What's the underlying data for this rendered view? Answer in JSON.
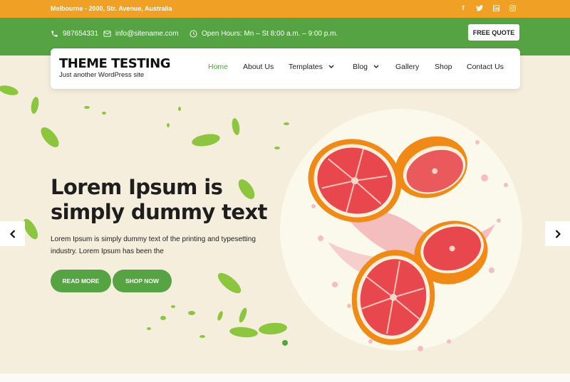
{
  "topbar": {
    "address": "Melbourne - 2000, Str. Avenue, Australia",
    "social": [
      {
        "icon": "facebook-icon",
        "glyph": "f"
      },
      {
        "icon": "twitter-icon",
        "glyph": "t"
      },
      {
        "icon": "linkedin-icon",
        "glyph": "in"
      },
      {
        "icon": "instagram-icon",
        "glyph": "◎"
      }
    ]
  },
  "infobar": {
    "phone": "987654331",
    "email": "info@sitename.com",
    "hours": "Open Hours: Mn – St 8:00 a.m. – 9:00 p.m.",
    "quote_button": "FREE QUOTE"
  },
  "header": {
    "site_title": "THEME TESTING",
    "tagline": "Just another WordPress site",
    "nav": [
      {
        "label": "Home",
        "active": true
      },
      {
        "label": "About Us"
      },
      {
        "label": "Templates",
        "dropdown": true
      },
      {
        "label": "Blog",
        "dropdown": true
      },
      {
        "label": "Gallery"
      },
      {
        "label": "Shop"
      },
      {
        "label": "Contact Us"
      }
    ]
  },
  "hero": {
    "headline_line1": "Lorem Ipsum is",
    "headline_line2": "simply dummy text",
    "description": "Lorem Ipsum is simply dummy text of the printing and typesetting industry. Lorem Ipsum has been the",
    "read_more": "READ MORE",
    "shop_now": "SHOP NOW",
    "prev_arrow": "‹",
    "next_arrow": "›"
  },
  "colors": {
    "topbar": "#f0a024",
    "infobar": "#55a343",
    "accent": "#55a343",
    "hero_bg": "#f6eedd"
  }
}
